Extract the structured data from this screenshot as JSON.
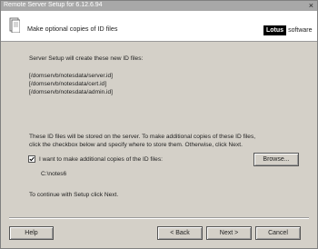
{
  "window": {
    "title": "Remote Server Setup for 6.12.6.94",
    "close_glyph": "×"
  },
  "header": {
    "title": "Make optional copies of ID files",
    "icon": "document-icon"
  },
  "brand": {
    "lotus": "Lotus",
    "software": "software"
  },
  "body": {
    "intro": "Server Setup will create these new ID files:",
    "files": [
      "[/domservb/notesdata/server.id]",
      "[/domservb/notesdata/cert.id]",
      "[/domservb/notesdata/admin.id]"
    ],
    "explain_line1": "These ID files will be stored on the server. To make additional copies of these ID files,",
    "explain_line2": "click the checkbox below and specify where to store them. Otherwise, click Next.",
    "checkbox_label": "I want to make additional copies of the ID files:",
    "checkbox_checked": true,
    "path": "C:\\notes6",
    "continue_text": "To continue with Setup click Next."
  },
  "buttons": {
    "browse": "Browse...",
    "help": "Help",
    "back": "< Back",
    "next": "Next >",
    "cancel": "Cancel"
  }
}
